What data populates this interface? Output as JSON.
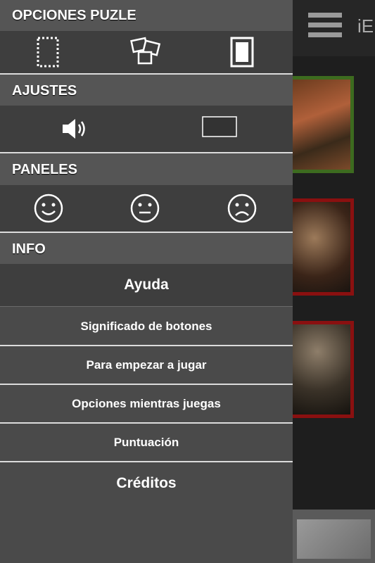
{
  "background_app": {
    "title_fragment": "iE"
  },
  "drawer": {
    "sections": {
      "puzzle": {
        "title": "OPCIONES PUZLE",
        "icons": [
          "dashed-frame-icon",
          "scattered-pieces-icon",
          "solid-frame-icon"
        ]
      },
      "settings": {
        "title": "AJUSTES",
        "icons": [
          "speaker-icon",
          "toggle-box-icon"
        ]
      },
      "panels": {
        "title": "PANELES",
        "icons": [
          "happy-face-icon",
          "neutral-face-icon",
          "sad-face-icon"
        ]
      },
      "info": {
        "title": "INFO",
        "items": [
          "Ayuda",
          "Significado de botones",
          "Para empezar a jugar",
          "Opciones mientras juegas",
          "Puntuación",
          "Créditos"
        ]
      }
    }
  },
  "colors": {
    "header_bg": "#555555",
    "body_bg": "#3e3e3e",
    "menu_bg": "#4a4a4a",
    "separator": "#dcdcdc"
  }
}
